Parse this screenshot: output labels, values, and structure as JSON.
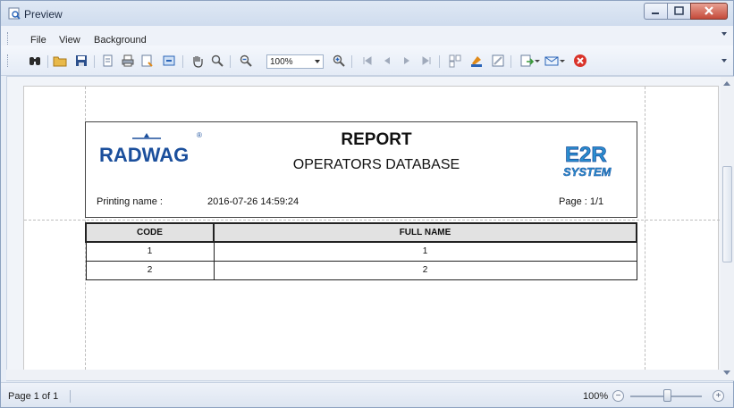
{
  "window": {
    "title": "Preview"
  },
  "menu": {
    "file": "File",
    "view": "View",
    "background": "Background"
  },
  "toolbar": {
    "zoom_value": "100%",
    "icons": [
      "find-icon",
      "open-icon",
      "save-icon",
      "page-setup-icon",
      "print-icon",
      "print-preview-icon",
      "export-icon",
      "hand-tool-icon",
      "magnifier-icon",
      "zoom-out-icon",
      "zoom-in-icon",
      "first-page-icon",
      "previous-page-icon",
      "next-page-icon",
      "last-page-icon",
      "multiple-pages-icon",
      "color-icon",
      "watermark-icon",
      "export-document-icon",
      "send-email-icon",
      "close-preview-icon"
    ]
  },
  "report": {
    "logo_text": "RADWAG",
    "logo_mark": "®",
    "title": "REPORT",
    "subtitle": "OPERATORS DATABASE",
    "system_logo_top": "E2R",
    "system_logo_bottom": "SYSTEM",
    "printing_name_label": "Printing name :",
    "printing_date": "2016-07-26 14:59:24",
    "page_label": "Page :  1/1"
  },
  "table": {
    "columns": [
      "CODE",
      "FULL NAME"
    ],
    "rows": [
      {
        "code": "1",
        "full_name": "1"
      },
      {
        "code": "2",
        "full_name": "2"
      }
    ]
  },
  "statusbar": {
    "page_info": "Page 1 of 1",
    "zoom": "100%",
    "zoom_out_symbol": "−",
    "zoom_in_symbol": "+"
  },
  "colors": {
    "accent": "#2a64b8",
    "window_border": "#8da2c0",
    "close_button": "#c44a3a",
    "logo_blue": "#1b4f9c"
  }
}
